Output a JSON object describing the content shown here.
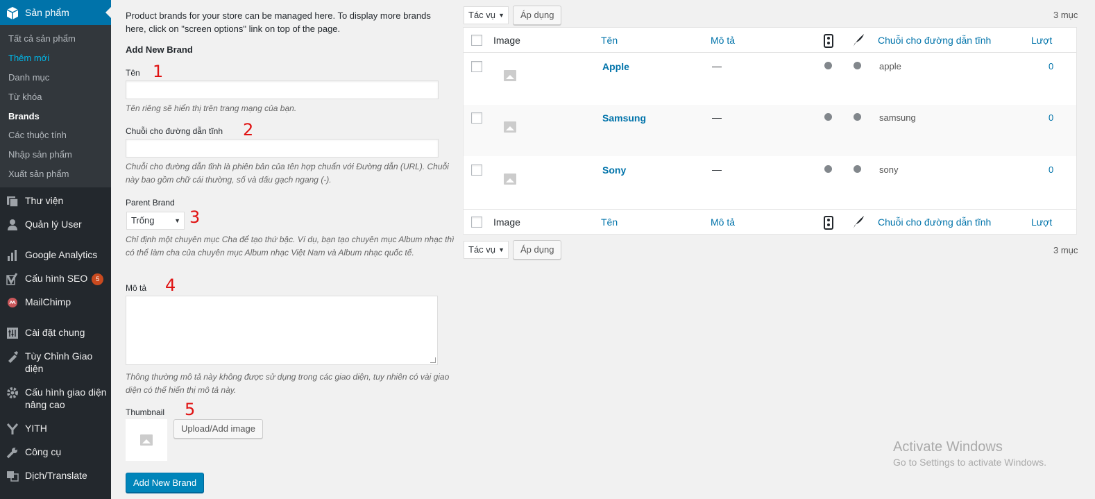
{
  "sidebar": {
    "current": "Sản phẩm",
    "submenu": [
      "Tất cả sản phẩm",
      "Thêm mới",
      "Danh mục",
      "Từ khóa",
      "Brands",
      "Các thuộc tính",
      "Nhập sản phẩm",
      "Xuất sản phẩm"
    ],
    "items": [
      {
        "label": "Thư viện",
        "icon": "media-icon"
      },
      {
        "label": "Quản lý User",
        "icon": "user-icon"
      },
      {
        "label": "Google Analytics",
        "icon": "analytics-icon"
      },
      {
        "label": "Cấu hình SEO",
        "icon": "yoast-icon",
        "badge": "5"
      },
      {
        "label": "MailChimp",
        "icon": "mailchimp-icon"
      },
      {
        "label": "Cài đặt chung",
        "icon": "settings-icon"
      },
      {
        "label": "Tùy Chỉnh Giao",
        "label2": "diện",
        "icon": "brush-icon"
      },
      {
        "label": "Cấu hình giao diện",
        "label2": "nâng cao",
        "icon": "gear-icon"
      },
      {
        "label": "YITH",
        "icon": "yith-icon"
      },
      {
        "label": "Công cụ",
        "icon": "wrench-icon"
      },
      {
        "label": "Dịch/Translate",
        "icon": "translate-icon"
      }
    ]
  },
  "form": {
    "intro": "Product brands for your store can be managed here. To display more brands here, click on \"screen options\" link on top of the page.",
    "heading": "Add New Brand",
    "name_label": "Tên",
    "name_desc": "Tên riêng sẽ hiển thị trên trang mạng của bạn.",
    "slug_label": "Chuỗi cho đường dẫn tĩnh",
    "slug_desc": "Chuỗi cho đường dẫn tĩnh là phiên bản của tên hợp chuẩn với Đường dẫn (URL). Chuỗi này bao gồm chữ cái thường, số và dấu gạch ngang (-).",
    "parent_label": "Parent Brand",
    "parent_selected": "Trống",
    "parent_desc": "Chỉ định một chuyên mục Cha để tạo thứ bậc. Ví dụ, bạn tạo chuyên mục Album nhạc thì có thể làm cha của chuyên mục Album nhạc Việt Nam và Album nhạc quốc tế.",
    "desc_label": "Mô tả",
    "desc_desc": "Thông thường mô tả này không được sử dụng trong các giao diện, tuy nhiên có vài giao diện có thể hiển thị mô tả này.",
    "thumb_label": "Thumbnail",
    "upload_label": "Upload/Add image",
    "submit_label": "Add New Brand",
    "annotations": [
      "1",
      "2",
      "3",
      "4",
      "5"
    ]
  },
  "table": {
    "bulk_action": "Tác vụ",
    "apply": "Áp dụng",
    "count": "3 mục",
    "headers": {
      "image": "Image",
      "name": "Tên",
      "desc": "Mô tả",
      "slug": "Chuỗi cho đường dẫn tĩnh",
      "count": "Lượt"
    },
    "rows": [
      {
        "name": "Apple",
        "desc": "—",
        "slug": "apple",
        "count": "0"
      },
      {
        "name": "Samsung",
        "desc": "—",
        "slug": "samsung",
        "count": "0"
      },
      {
        "name": "Sony",
        "desc": "—",
        "slug": "sony",
        "count": "0"
      }
    ]
  },
  "watermark": {
    "title": "Activate Windows",
    "subtitle": "Go to Settings to activate Windows."
  }
}
